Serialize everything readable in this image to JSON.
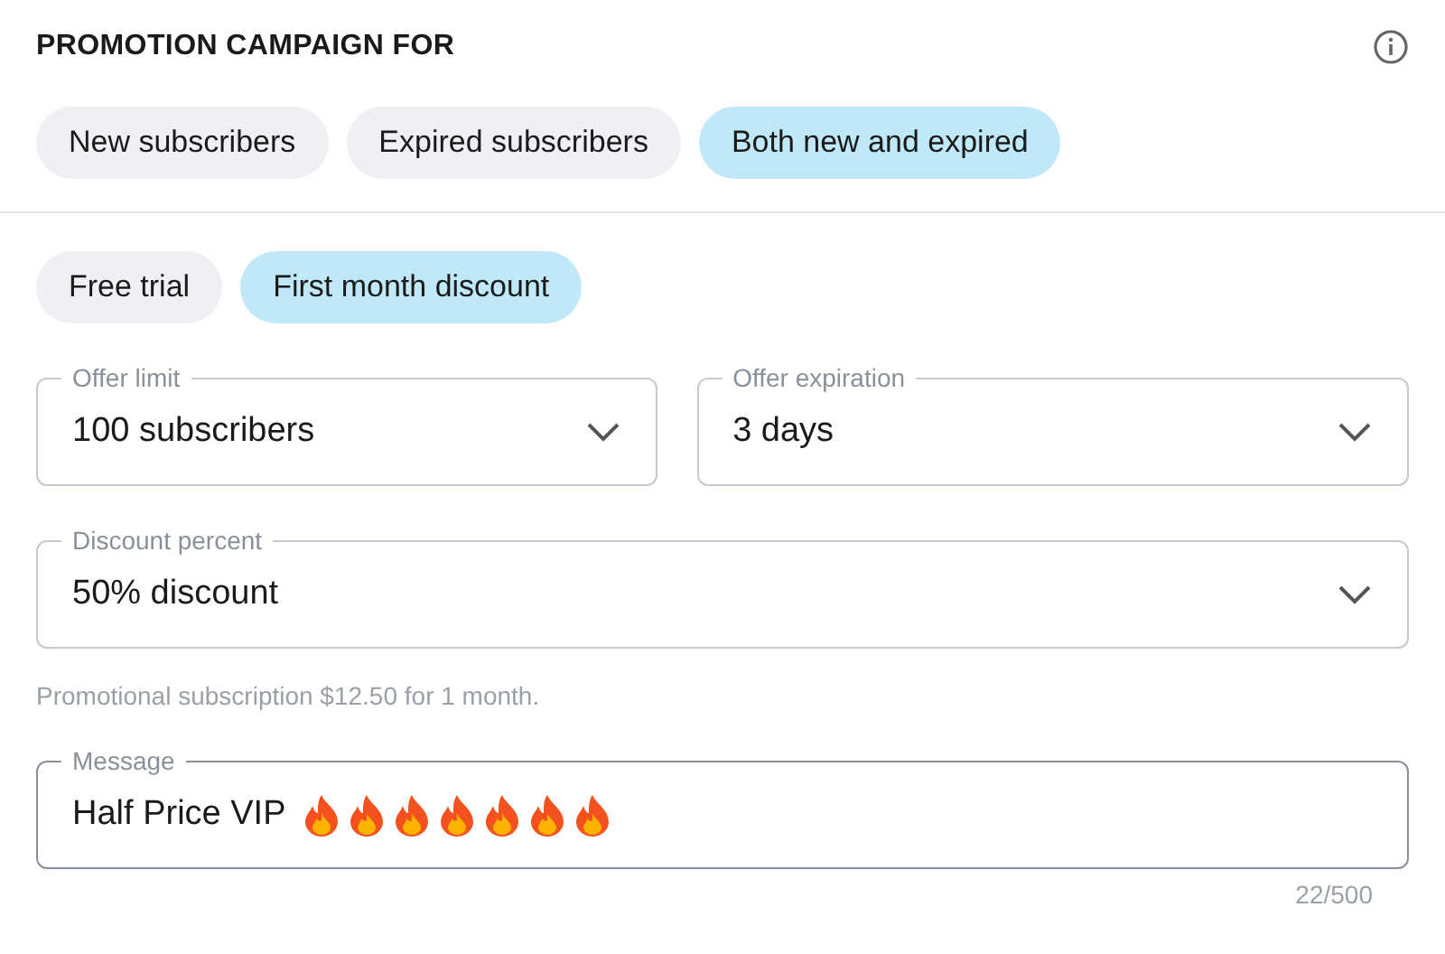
{
  "title": "PROMOTION CAMPAIGN FOR",
  "audience": [
    {
      "label": "New subscribers",
      "selected": false
    },
    {
      "label": "Expired subscribers",
      "selected": false
    },
    {
      "label": "Both new and expired",
      "selected": true
    }
  ],
  "offer_types": [
    {
      "label": "Free trial",
      "selected": false
    },
    {
      "label": "First month discount",
      "selected": true
    }
  ],
  "offer_limit": {
    "label": "Offer limit",
    "value": "100 subscribers"
  },
  "offer_expiration": {
    "label": "Offer expiration",
    "value": "3 days"
  },
  "discount_percent": {
    "label": "Discount percent",
    "value": "50% discount"
  },
  "helper": "Promotional subscription $12.50 for 1 month.",
  "message": {
    "label": "Message",
    "value": "Half Price VIP",
    "icons": [
      {
        "kind": "fire"
      },
      {
        "kind": "fire"
      },
      {
        "kind": "fire"
      },
      {
        "kind": "fire"
      },
      {
        "kind": "fire"
      },
      {
        "kind": "fire"
      },
      {
        "kind": "fire"
      }
    ]
  },
  "counter": "22/500"
}
